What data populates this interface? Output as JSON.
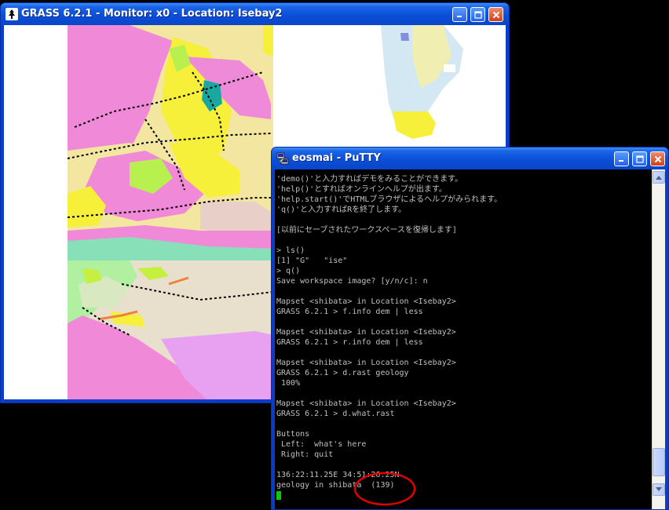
{
  "grass_window": {
    "title": "GRASS 6.2.1 - Monitor: x0 - Location: Isebay2",
    "icon": "grass-icon"
  },
  "putty_window": {
    "title": "eosmai - PuTTY",
    "icon": "putty-icon",
    "lines": [
      "'demo()'と入力すればデモをみることができます。",
      "'help()'とすればオンラインヘルプが出ます。",
      "'help.start()'でHTMLブラウザによるヘルプがみられます。",
      "'q()'と入力すればRを終了します。",
      "",
      "[以前にセーブされたワークスペースを復帰します]",
      "",
      "> ls()",
      "[1] \"G\"   \"ise\"",
      "> q()",
      "Save workspace image? [y/n/c]: n",
      "",
      "Mapset <shibata> in Location <Isebay2>",
      "GRASS 6.2.1 > f.info dem | less",
      "",
      "Mapset <shibata> in Location <Isebay2>",
      "GRASS 6.2.1 > r.info dem | less",
      "",
      "Mapset <shibata> in Location <Isebay2>",
      "GRASS 6.2.1 > d.rast geology",
      " 100%",
      "",
      "Mapset <shibata> in Location <Isebay2>",
      "GRASS 6.2.1 > d.what.rast",
      "",
      "Buttons",
      " Left:  what's here",
      " Right: quit",
      "",
      "136:22:11.25E 34:51:26.25N",
      "geology in shibata  (139)"
    ]
  },
  "colors": {
    "title_bar": "#0a45c8",
    "annotation_ring": "#e00000",
    "cursor": "#00d000"
  }
}
